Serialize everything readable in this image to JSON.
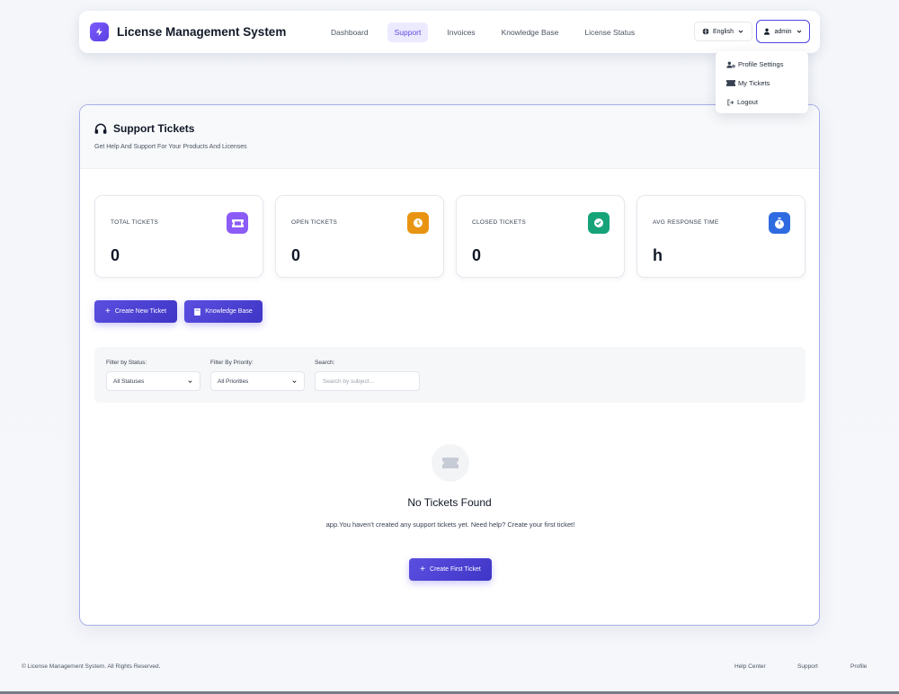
{
  "app": {
    "title": "License Management System"
  },
  "nav": {
    "links": [
      "Dashboard",
      "Support",
      "Invoices",
      "Knowledge Base",
      "License Status"
    ],
    "active": "Support",
    "language": "English",
    "user": "admin"
  },
  "user_menu": {
    "items": [
      "Profile Settings",
      "My Tickets",
      "Logout"
    ]
  },
  "page": {
    "title": "Support Tickets",
    "subtitle": "Get Help And Support For Your Products And Licenses"
  },
  "stats": [
    {
      "label": "TOTAL TICKETS",
      "value": "0",
      "icon": "ticket-icon",
      "color": "#8b5cf6"
    },
    {
      "label": "OPEN TICKETS",
      "value": "0",
      "icon": "clock-icon",
      "color": "#e89412"
    },
    {
      "label": "CLOSED TICKETS",
      "value": "0",
      "icon": "check-circle-icon",
      "color": "#16a37a"
    },
    {
      "label": "AVG RESPONSE TIME",
      "value": "h",
      "icon": "stopwatch-icon",
      "color": "#2f6be0"
    }
  ],
  "actions": {
    "create_ticket": "Create New Ticket",
    "knowledge_base": "Knowledge Base"
  },
  "filters": {
    "status_label": "Filter by Status:",
    "status_value": "All Statuses",
    "priority_label": "Filter By Priority:",
    "priority_value": "All Priorities",
    "search_label": "Search:",
    "search_placeholder": "Search by subject..."
  },
  "empty": {
    "title": "No Tickets Found",
    "text": "app.You haven't created any support tickets yet. Need help? Create your first ticket!",
    "button": "Create First Ticket"
  },
  "footer": {
    "copyright": "© License Management System. All Rights Reserved.",
    "links": [
      "Help Center",
      "Support",
      "Profile"
    ]
  },
  "colors": {
    "accent": "#4f46e5",
    "accent_light": "#eceaff"
  }
}
